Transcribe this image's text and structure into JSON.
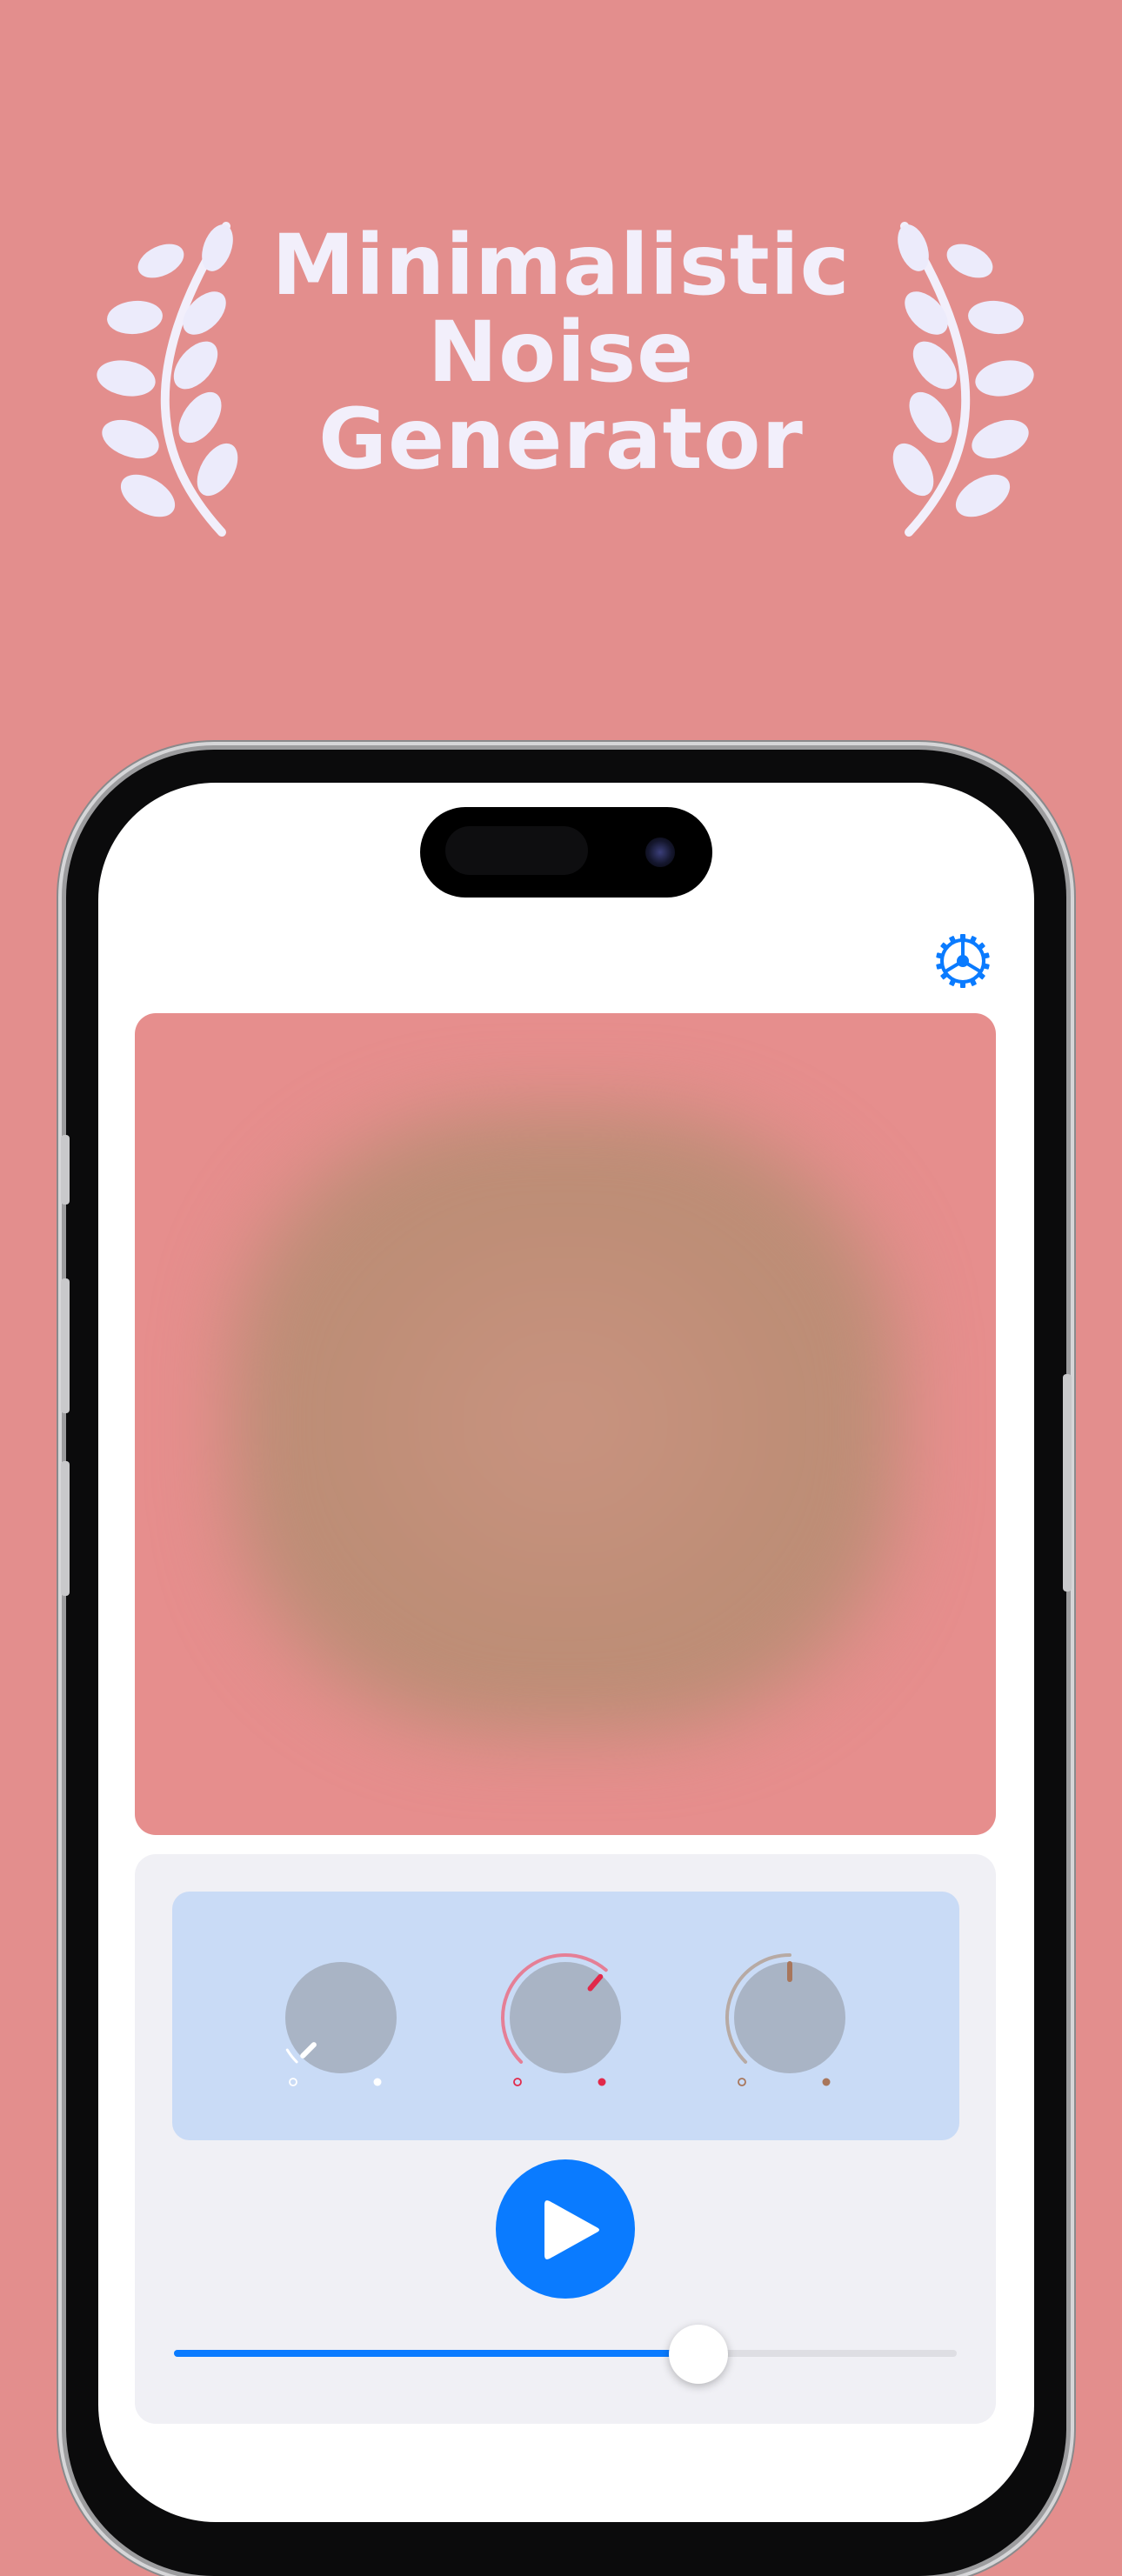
{
  "headline": {
    "line1": "Minimalistic",
    "line2": "Noise",
    "line3": "Generator"
  },
  "colors": {
    "background": "#e38e8d",
    "accent": "#0a7bff",
    "preview": "#e68e8d",
    "knob_panel": "#c9dbf6",
    "knob_white": "#ffffff",
    "knob_pink": "#e1294a",
    "knob_brown": "#a8765b"
  },
  "icons": {
    "settings": "gear-icon",
    "play": "play-icon",
    "laurel": "laurel-icon"
  },
  "knobs": [
    {
      "name": "white-noise-knob",
      "level": 0.0,
      "color": "#ffffff"
    },
    {
      "name": "pink-noise-knob",
      "level": 0.65,
      "color": "#e1294a"
    },
    {
      "name": "brown-noise-knob",
      "level": 0.5,
      "color": "#a8765b"
    }
  ],
  "volume": {
    "level": 0.67
  }
}
